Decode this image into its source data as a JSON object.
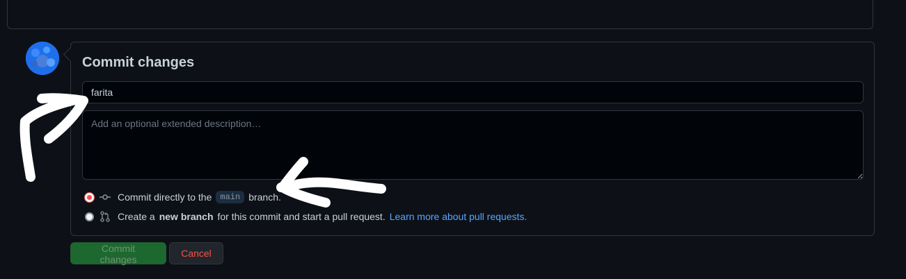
{
  "commit_form": {
    "heading": "Commit changes",
    "summary_value": "farita",
    "description_placeholder": "Add an optional extended description…",
    "option_direct": {
      "prefix": "Commit directly to the",
      "branch": "main",
      "suffix": "branch.",
      "selected": true
    },
    "option_new_branch": {
      "prefix": "Create a",
      "bold": "new branch",
      "suffix": "for this commit and start a pull request.",
      "link": "Learn more about pull requests.",
      "selected": false
    },
    "commit_button_label": "Commit changes",
    "cancel_button_label": "Cancel"
  },
  "icons": {
    "commit": "git-commit-icon",
    "pull_request": "git-pull-request-icon"
  },
  "colors": {
    "background": "#0d1117",
    "border": "#30363d",
    "link": "#58a6ff",
    "primary_button": "#238636",
    "danger_text": "#f85149"
  }
}
